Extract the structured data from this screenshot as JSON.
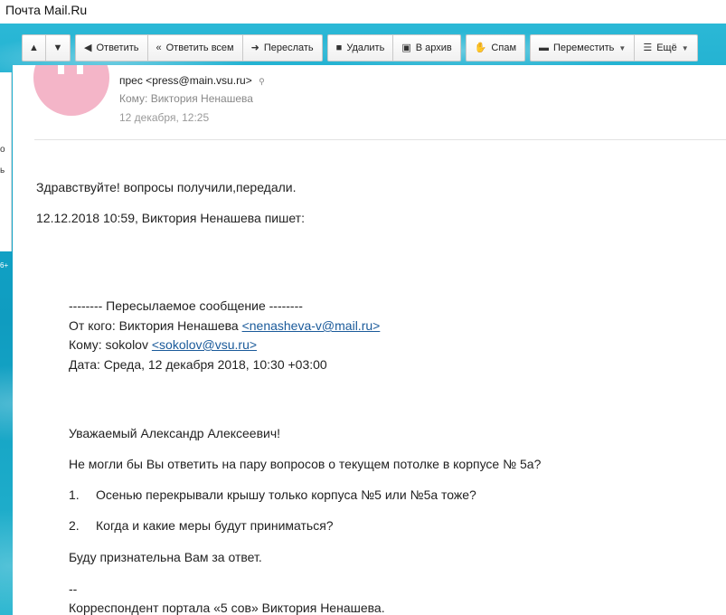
{
  "window": {
    "title": "Почта Mail.Ru"
  },
  "toolbar": {
    "up_icon": "arrow-up-icon",
    "down_icon": "arrow-down-icon",
    "reply": "Ответить",
    "reply_all": "Ответить всем",
    "forward": "Переслать",
    "delete": "Удалить",
    "archive": "В архив",
    "spam": "Спам",
    "move": "Переместить",
    "more": "Ещё"
  },
  "left_panel": {
    "frag1": "о",
    "frag2": "ь",
    "badge": "6+"
  },
  "message": {
    "from": "прес <press@main.vsu.ru>",
    "to": "Кому: Виктория Ненашева",
    "date": "12 декабря, 12:25",
    "greeting": "Здравствуйте! вопросы получили,передали.",
    "quote_header": "12.12.2018 10:59, Виктория Ненашева пишет:",
    "forwarded": {
      "separator": "-------- Пересылаемое сообщение --------",
      "from_label": "От кого: Виктория Ненашева ",
      "from_link": "<nenasheva-v@mail.ru>",
      "to_label": "Кому: sokolov ",
      "to_link": "<sokolov@vsu.ru>",
      "date": "Дата: Среда, 12 декабря 2018, 10:30 +03:00"
    },
    "salutation": "Уважаемый Александр Алексеевич!",
    "question_intro": " Не могли бы Вы ответить на пару вопросов о текущем потолке в корпусе № 5а?",
    "questions": [
      {
        "num": "1.",
        "text": "Осенью перекрывали крышу только корпуса №5 или №5а тоже?"
      },
      {
        "num": "2.",
        "text": "Когда и какие меры будут приниматься?"
      }
    ],
    "closing": "Буду признательна Вам за ответ.",
    "sig_dash": "--",
    "signature": "Корреспондент портала «5 сов» Виктория Ненашева."
  }
}
